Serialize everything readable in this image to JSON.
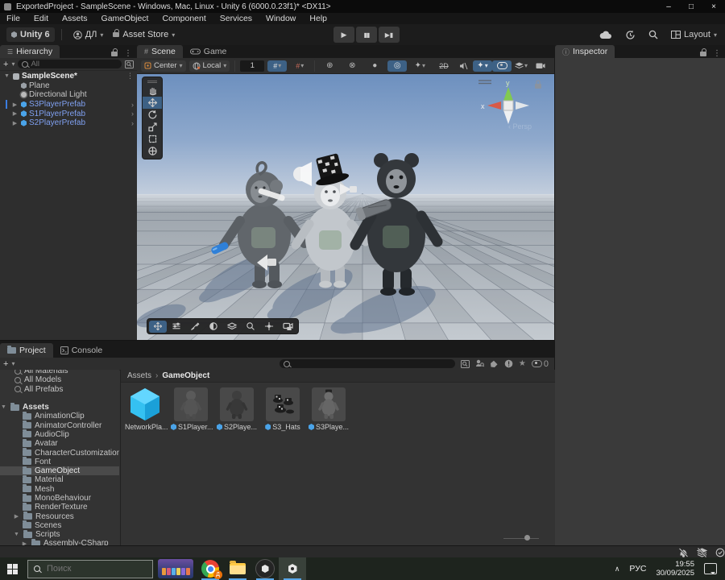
{
  "icons": {
    "kebab": "⋮",
    "chevron_down": "▾",
    "fold_open": "▼",
    "fold_closed": "▶",
    "caret_right": "›",
    "caret_left": "‹",
    "plus": "+",
    "star": "★",
    "hamburger": "☰",
    "minimize": "–",
    "maximize": "□",
    "close": "×",
    "play": "▶",
    "pause": "▮▮",
    "step": "▶▮",
    "up": "▲",
    "down": "▼",
    "twod": "2D",
    "gizmo_circle": "⊕",
    "gizmo_dot": "⊗",
    "sphere": "●",
    "ring": "◎",
    "sparkle": "✦",
    "caret_up": "∧",
    "grid": "#",
    "info": "ⓘ"
  },
  "titlebar": {
    "title": "ExportedProject - SampleScene - Windows, Mac, Linux - Unity 6 (6000.0.23f1)* <DX11>"
  },
  "menubar": {
    "items": [
      "File",
      "Edit",
      "Assets",
      "GameObject",
      "Component",
      "Services",
      "Window",
      "Help"
    ]
  },
  "toolbar": {
    "unity_badge": "Unity 6",
    "account_initials": "ДЛ",
    "asset_store": "Asset Store",
    "layout": "Layout"
  },
  "hierarchy": {
    "tab": "Hierarchy",
    "search_placeholder": "All",
    "scene_name": "SampleScene*",
    "items": [
      {
        "label": "Plane"
      },
      {
        "label": "Directional Light"
      },
      {
        "label": "S3PlayerPrefab"
      },
      {
        "label": "S1PlayerPrefab"
      },
      {
        "label": "S2PlayerPrefab"
      }
    ]
  },
  "scene_view": {
    "tab_scene": "Scene",
    "tab_game": "Game",
    "pivot": "Center",
    "space": "Local",
    "snap_value": "1",
    "axis_x": "x",
    "axis_y": "y",
    "persp": "Persp"
  },
  "inspector": {
    "tab": "Inspector"
  },
  "project": {
    "tab_project": "Project",
    "tab_console": "Console",
    "favorites": [
      "All Materials",
      "All Models",
      "All Prefabs"
    ],
    "root": "Assets",
    "folders": [
      "AnimationClip",
      "AnimatorController",
      "AudioClip",
      "Avatar",
      "CharacterCustomization",
      "Font",
      "GameObject",
      "Material",
      "Mesh",
      "MonoBehaviour",
      "RenderTexture",
      "Resources",
      "Scenes",
      "Scripts"
    ],
    "subfolder": "Assembly-CSharp",
    "breadcrumb_root": "Assets",
    "breadcrumb_current": "GameObject",
    "assets": [
      {
        "label": "NetworkPla..."
      },
      {
        "label": "S1Player..."
      },
      {
        "label": "S2Playe..."
      },
      {
        "label": "S3_Hats"
      },
      {
        "label": "S3Playe..."
      }
    ],
    "hidden_count": "0"
  },
  "taskbar": {
    "search_placeholder": "Поиск",
    "chrome_badge": "Д",
    "language": "РУС",
    "time": "19:55",
    "date": "30/09/2025"
  }
}
